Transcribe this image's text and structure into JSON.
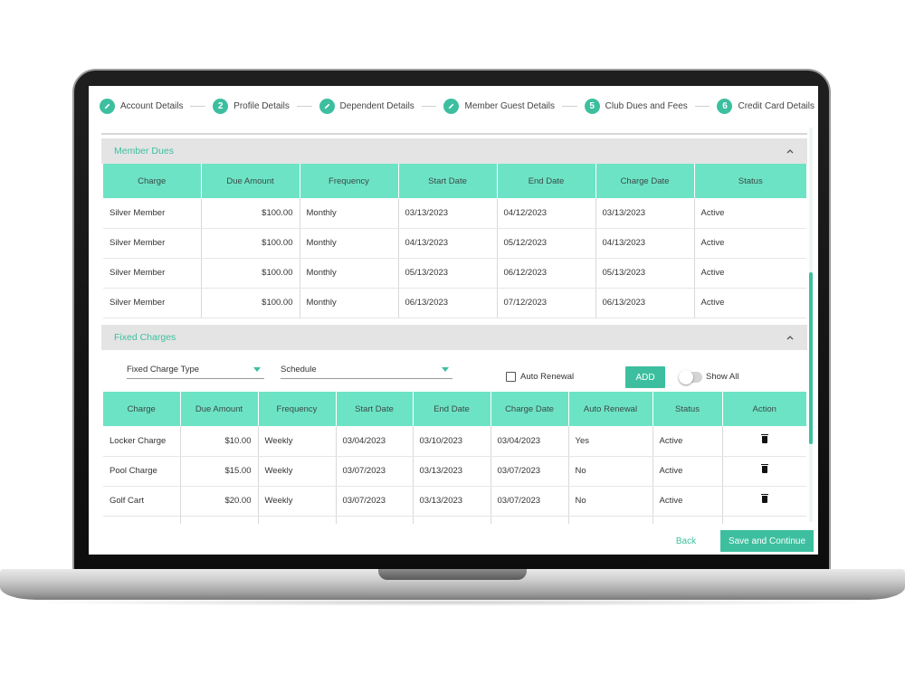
{
  "stepper": [
    {
      "label": "Account Details",
      "marker": "",
      "icon": "pencil-icon"
    },
    {
      "label": "Profile Details",
      "marker": "2",
      "icon": ""
    },
    {
      "label": "Dependent Details",
      "marker": "",
      "icon": "pencil-icon"
    },
    {
      "label": "Member Guest Details",
      "marker": "",
      "icon": "pencil-icon"
    },
    {
      "label": "Club Dues and Fees",
      "marker": "5",
      "icon": ""
    },
    {
      "label": "Credit Card Details",
      "marker": "6",
      "icon": ""
    }
  ],
  "member_dues": {
    "title": "Member Dues",
    "columns": [
      "Charge",
      "Due Amount",
      "Frequency",
      "Start Date",
      "End Date",
      "Charge Date",
      "Status"
    ],
    "rows": [
      [
        "Silver Member",
        "$100.00",
        "Monthly",
        "03/13/2023",
        "04/12/2023",
        "03/13/2023",
        "Active"
      ],
      [
        "Silver Member",
        "$100.00",
        "Monthly",
        "04/13/2023",
        "05/12/2023",
        "04/13/2023",
        "Active"
      ],
      [
        "Silver Member",
        "$100.00",
        "Monthly",
        "05/13/2023",
        "06/12/2023",
        "05/13/2023",
        "Active"
      ],
      [
        "Silver Member",
        "$100.00",
        "Monthly",
        "06/13/2023",
        "07/12/2023",
        "06/13/2023",
        "Active"
      ]
    ]
  },
  "fixed_charges": {
    "title": "Fixed Charges",
    "type_select_value": "Fixed Charge Type",
    "schedule_select_value": "Schedule",
    "auto_renewal_label": "Auto Renewal",
    "add_label": "ADD",
    "show_all_label": "Show All",
    "columns": [
      "Charge",
      "Due Amount",
      "Frequency",
      "Start Date",
      "End Date",
      "Charge Date",
      "Auto Renewal",
      "Status",
      "Action"
    ],
    "rows": [
      [
        "Locker Charge",
        "$10.00",
        "Weekly",
        "03/04/2023",
        "03/10/2023",
        "03/04/2023",
        "Yes",
        "Active"
      ],
      [
        "Pool Charge",
        "$15.00",
        "Weekly",
        "03/07/2023",
        "03/13/2023",
        "03/07/2023",
        "No",
        "Active"
      ],
      [
        "Golf Cart",
        "$20.00",
        "Weekly",
        "03/07/2023",
        "03/13/2023",
        "03/07/2023",
        "No",
        "Active"
      ]
    ]
  },
  "footer": {
    "back_label": "Back",
    "save_label": "Save and Continue"
  },
  "colors": {
    "accent": "#3dbf9f",
    "table_header": "#6de3c6",
    "section_header": "#e4e4e4"
  }
}
